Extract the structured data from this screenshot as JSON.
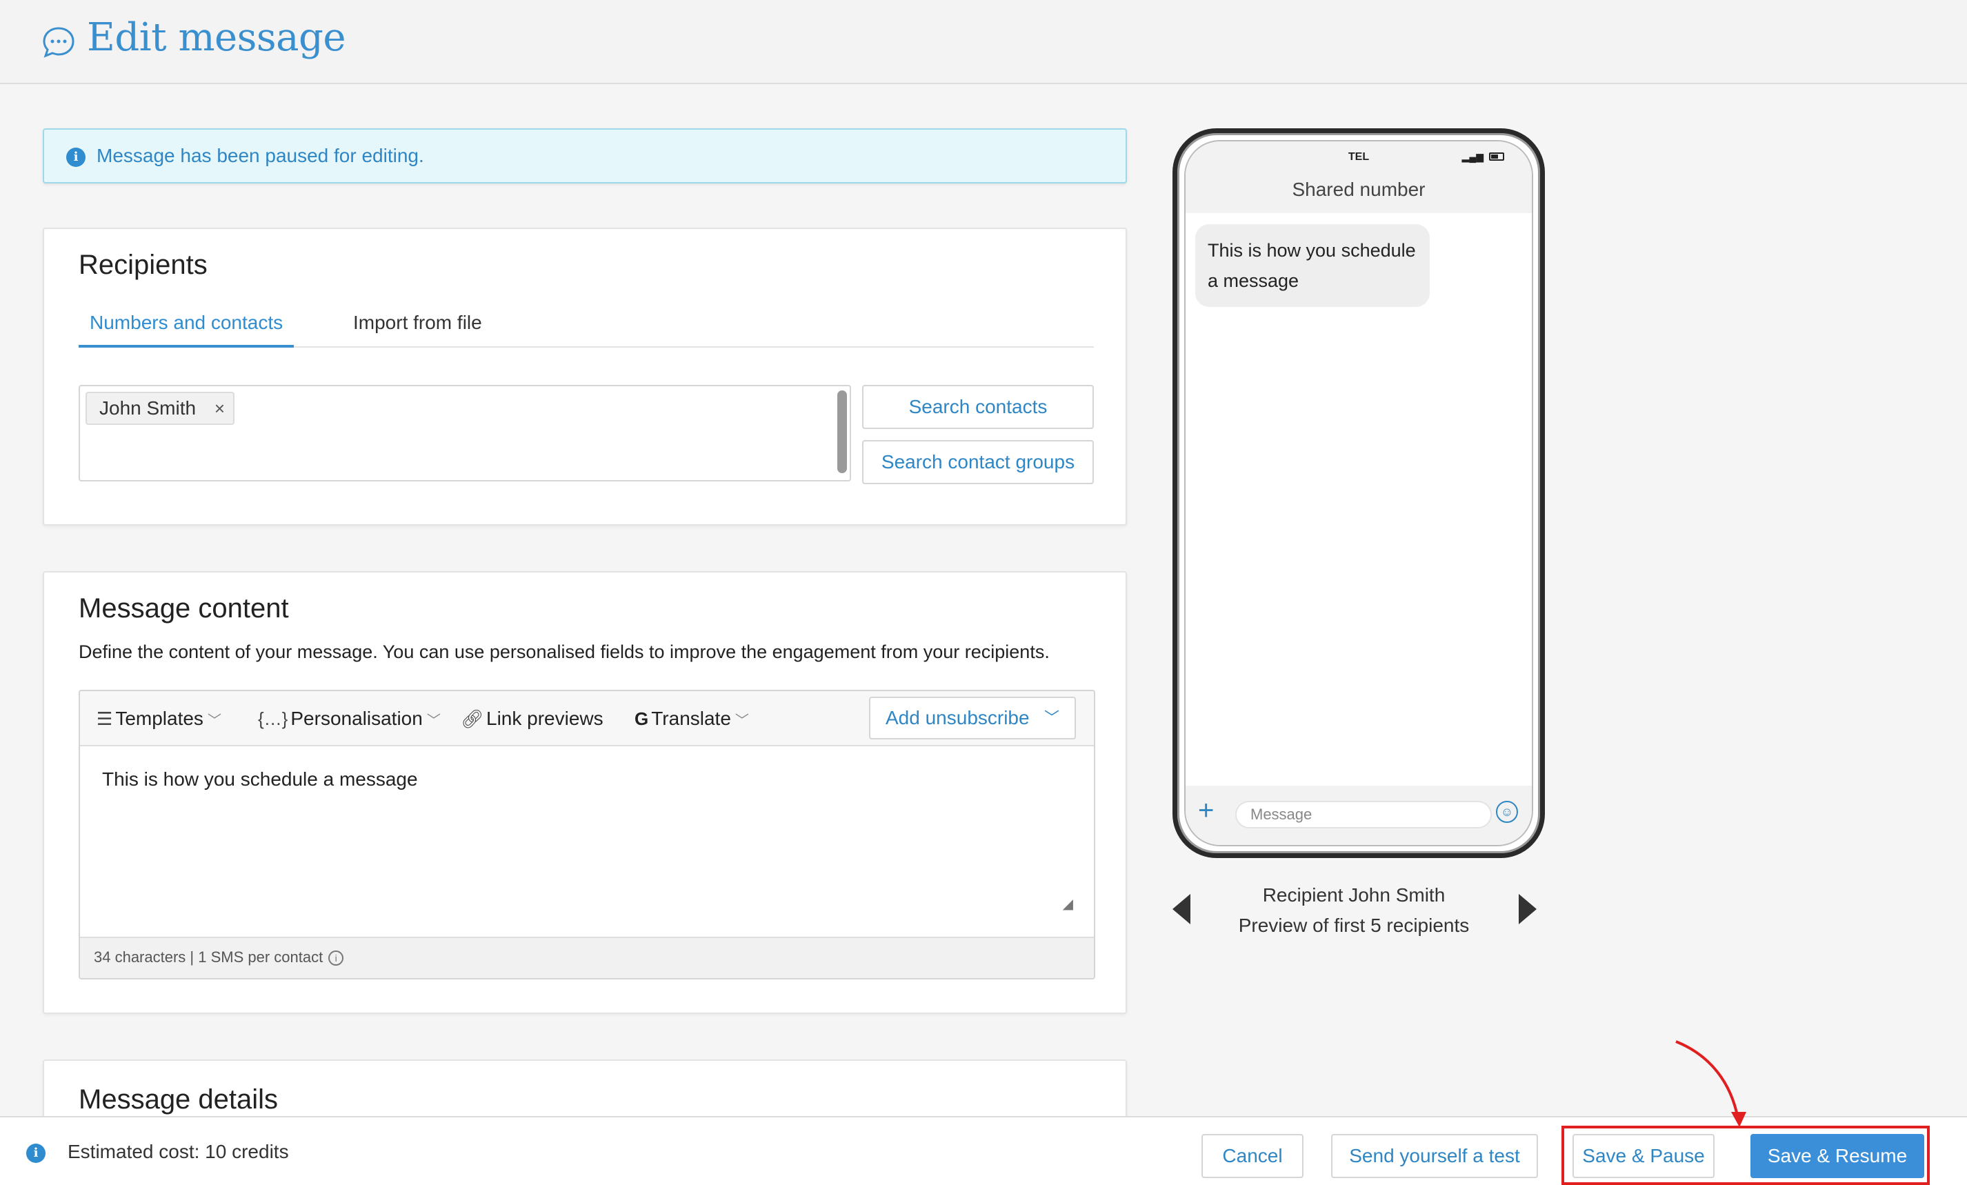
{
  "header": {
    "title": "Edit message",
    "icon": "chat-bubble-icon"
  },
  "banner": {
    "text": "Message has been paused for editing."
  },
  "recipients": {
    "title": "Recipients",
    "tabs": [
      {
        "label": "Numbers and contacts",
        "active": true
      },
      {
        "label": "Import from file",
        "active": false
      }
    ],
    "chips": [
      {
        "label": "John Smith",
        "remove": "×"
      }
    ],
    "search_contacts": "Search contacts",
    "search_groups": "Search contact groups"
  },
  "content": {
    "title": "Message content",
    "description": "Define the content of your message. You can use personalised fields to improve the engagement from your recipients.",
    "toolbar": {
      "templates": "Templates",
      "personalisation": "Personalisation",
      "link_previews": "Link previews",
      "translate": "Translate",
      "add_unsubscribe": "Add unsubscribe"
    },
    "message": "This is how you schedule a message",
    "stats": "34 characters | 1 SMS per contact"
  },
  "details": {
    "title": "Message details"
  },
  "preview": {
    "carrier": "TEL",
    "sender": "Shared number",
    "bubble": "This is how you schedule a message",
    "composer_placeholder": "Message",
    "recipient_line": "Recipient John Smith",
    "preview_line": "Preview of first 5 recipients"
  },
  "footer": {
    "cost": "Estimated cost: 10 credits",
    "cancel": "Cancel",
    "send_test": "Send yourself a test",
    "save_pause": "Save & Pause",
    "save_resume": "Save & Resume"
  },
  "colors": {
    "accent": "#3a8fcf",
    "primary_button": "#3a8fd8",
    "banner_bg": "#e6f7fb",
    "highlight": "#e02020"
  }
}
